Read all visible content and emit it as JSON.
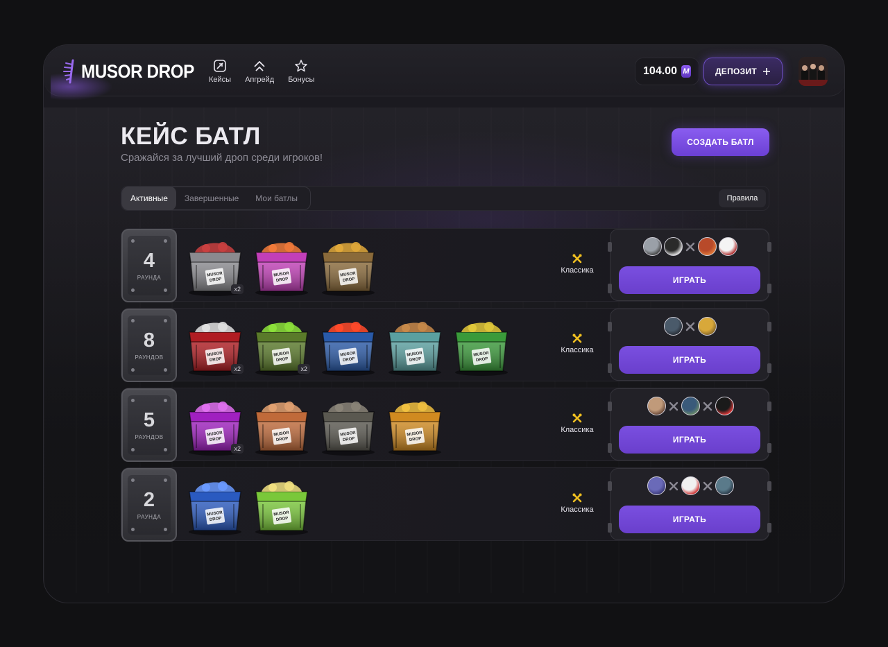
{
  "brand": {
    "name": "MUSOR DROP"
  },
  "nav": [
    {
      "label": "Кейсы",
      "icon": "cases-icon"
    },
    {
      "label": "Апгрейд",
      "icon": "upgrade-icon"
    },
    {
      "label": "Бонусы",
      "icon": "bonus-icon"
    }
  ],
  "balance": {
    "amount": "104.00",
    "currency_glyph": "M"
  },
  "deposit": {
    "label": "ДЕПОЗИТ",
    "icon": "plus-icon"
  },
  "page": {
    "title": "КЕЙС БАТЛ",
    "subtitle": "Сражайся за лучший дроп среди игроков!",
    "create_label": "СОЗДАТЬ БАТЛ"
  },
  "tabs": [
    {
      "label": "Активные",
      "active": true
    },
    {
      "label": "Завершенные",
      "active": false
    },
    {
      "label": "Мои батлы",
      "active": false
    }
  ],
  "rules_label": "Правила",
  "battles": [
    {
      "rounds": "4",
      "rounds_label": "РАУНДА",
      "mode": "Классика",
      "play_label": "ИГРАТЬ",
      "cases": [
        {
          "name": "ghost-case",
          "multiplier": "x2",
          "color": "#8a8a8f",
          "accent": "#c94040"
        },
        {
          "name": "pink-knife-case",
          "multiplier": "",
          "color": "#c23fb8",
          "accent": "#f07a3a"
        },
        {
          "name": "gold-coins-case",
          "multiplier": "",
          "color": "#8a6a3a",
          "accent": "#e0a83a"
        }
      ],
      "players": [
        [
          "#9aa0a8",
          "#444"
        ],
        [
          "#2a2a2a",
          "#ddd"
        ],
        [
          "#b84a2a",
          "#e07a3a"
        ],
        [
          "#f4f4f4",
          "#b02a2a"
        ]
      ],
      "separators": [
        2
      ]
    },
    {
      "rounds": "8",
      "rounds_label": "РАУНДОВ",
      "mode": "Классика",
      "play_label": "ИГРАТЬ",
      "cases": [
        {
          "name": "blood-case",
          "multiplier": "x2",
          "color": "#b01c22",
          "accent": "#e0e0e0"
        },
        {
          "name": "toxic-case",
          "multiplier": "x2",
          "color": "#5a7a2a",
          "accent": "#8ce03a"
        },
        {
          "name": "counter-case",
          "multiplier": "",
          "color": "#2a5aa8",
          "accent": "#ff4a2a"
        },
        {
          "name": "teal-case",
          "multiplier": "",
          "color": "#5aa0a0",
          "accent": "#c88a4a"
        },
        {
          "name": "green-lounge-case",
          "multiplier": "",
          "color": "#3a9a3a",
          "accent": "#e0c83a"
        }
      ],
      "players": [
        [
          "#4a5a6a",
          "#2a3038"
        ],
        [
          "#d8a83a",
          "#8a6a2a"
        ]
      ],
      "separators": [
        1
      ]
    },
    {
      "rounds": "5",
      "rounds_label": "РАУНДОВ",
      "mode": "Классика",
      "play_label": "ИГРАТЬ",
      "cases": [
        {
          "name": "purple-case",
          "multiplier": "x2",
          "color": "#a020c0",
          "accent": "#e070f0"
        },
        {
          "name": "pizza-case",
          "multiplier": "",
          "color": "#c06a3a",
          "accent": "#e0a070"
        },
        {
          "name": "soldier-case",
          "multiplier": "",
          "color": "#5a5850",
          "accent": "#8a8478"
        },
        {
          "name": "fire-case",
          "multiplier": "",
          "color": "#d08a20",
          "accent": "#f0c040"
        }
      ],
      "players": [
        [
          "#c09a7a",
          "#6a4a3a"
        ],
        [
          "#3a5a7a",
          "#6a8a6a"
        ],
        [
          "#1a1a1a",
          "#e03a3a"
        ]
      ],
      "separators": [
        1,
        2
      ]
    },
    {
      "rounds": "2",
      "rounds_label": "РАУНДА",
      "mode": "Классика",
      "play_label": "ИГРАТЬ",
      "cases": [
        {
          "name": "blue-case",
          "multiplier": "",
          "color": "#2a5ac0",
          "accent": "#6a9aff"
        },
        {
          "name": "lime-case",
          "multiplier": "",
          "color": "#7ac83a",
          "accent": "#f0e080"
        }
      ],
      "players": [
        [
          "#6a6ab8",
          "#3a3a7a"
        ],
        [
          "#f0f0f0",
          "#d03030"
        ],
        [
          "#5a7a8a",
          "#2a3a48"
        ]
      ],
      "separators": [
        1,
        2
      ]
    }
  ],
  "colors": {
    "accent": "#7a4fe0",
    "panel": "#1d1c22",
    "bg": "#111113"
  }
}
